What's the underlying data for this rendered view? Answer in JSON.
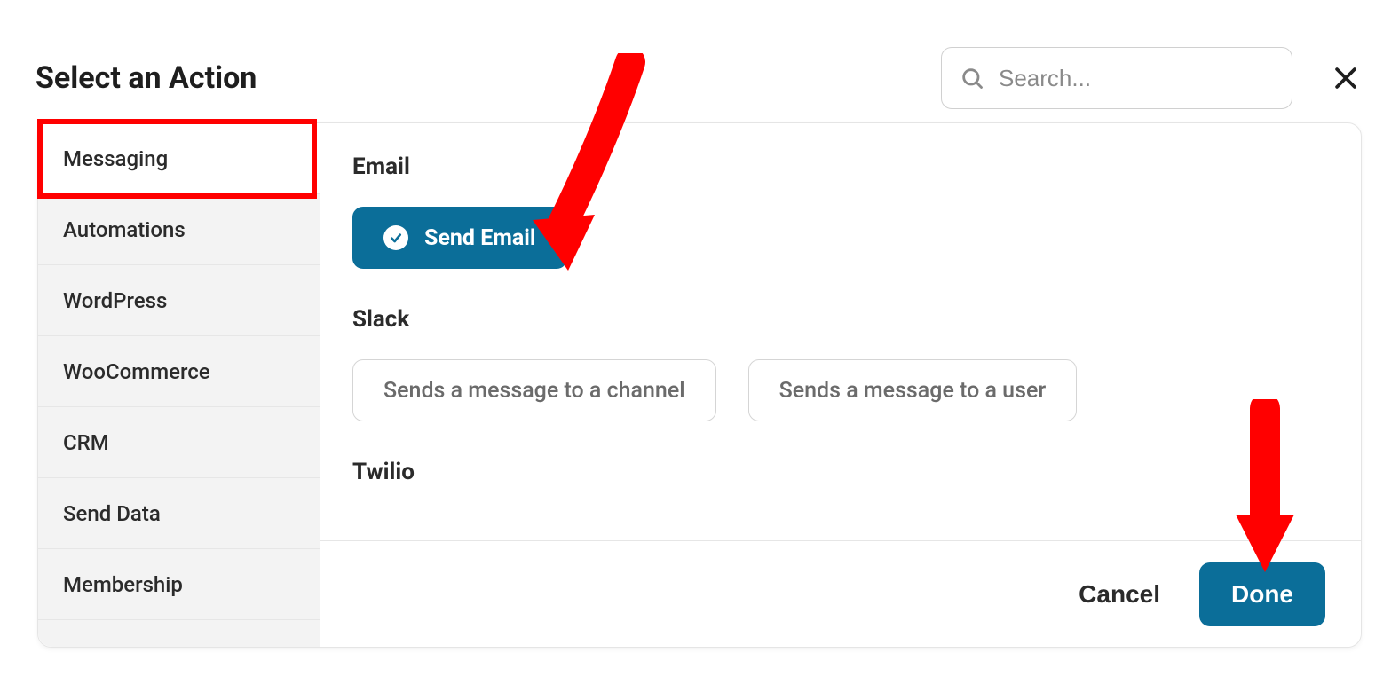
{
  "header": {
    "title": "Select an Action",
    "search_placeholder": "Search..."
  },
  "sidebar": {
    "items": [
      {
        "label": "Messaging",
        "active": true
      },
      {
        "label": "Automations",
        "active": false
      },
      {
        "label": "WordPress",
        "active": false
      },
      {
        "label": "WooCommerce",
        "active": false
      },
      {
        "label": "CRM",
        "active": false
      },
      {
        "label": "Send Data",
        "active": false
      },
      {
        "label": "Membership",
        "active": false
      }
    ]
  },
  "content": {
    "groups": [
      {
        "title": "Email",
        "chips": [
          {
            "label": "Send Email",
            "selected": true
          }
        ]
      },
      {
        "title": "Slack",
        "chips": [
          {
            "label": "Sends a message to a channel",
            "selected": false
          },
          {
            "label": "Sends a message to a user",
            "selected": false
          }
        ]
      },
      {
        "title": "Twilio",
        "chips": []
      }
    ]
  },
  "footer": {
    "cancel_label": "Cancel",
    "done_label": "Done"
  },
  "annotations": {
    "highlight": "red-box-around-messaging-tab",
    "arrows": [
      "arrow-to-send-email",
      "arrow-to-done-button"
    ]
  },
  "colors": {
    "accent": "#0b6e99",
    "annotation": "#ff0000"
  }
}
